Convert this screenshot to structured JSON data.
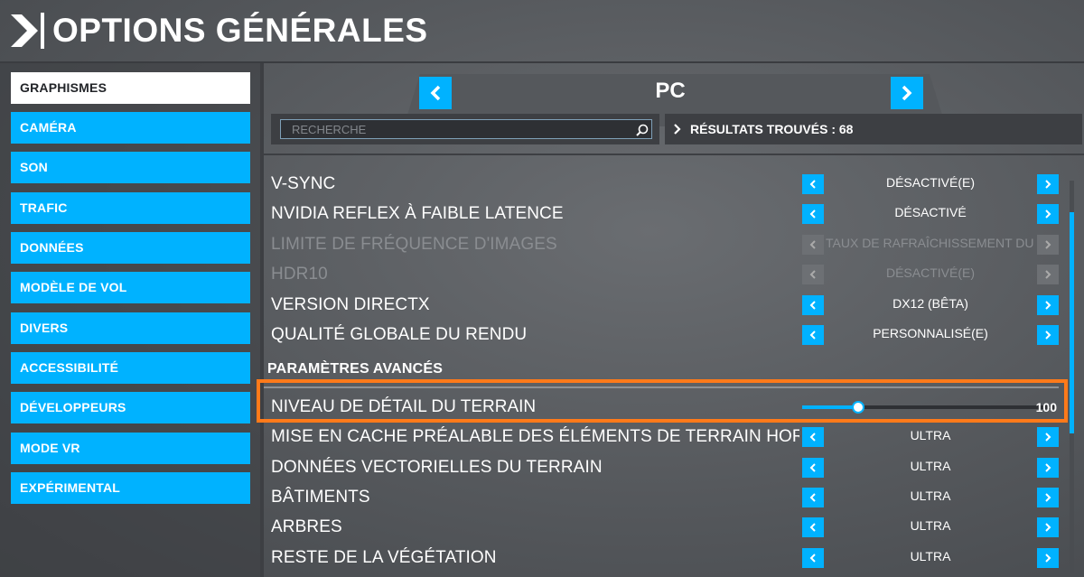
{
  "header": {
    "title": "OPTIONS GÉNÉRALES",
    "back_icon": "chevron-right-icon"
  },
  "sidebar": {
    "items": [
      {
        "label": "GRAPHISMES",
        "active": true
      },
      {
        "label": "CAMÉRA",
        "active": false
      },
      {
        "label": "SON",
        "active": false
      },
      {
        "label": "TRAFIC",
        "active": false
      },
      {
        "label": "DONNÉES",
        "active": false
      },
      {
        "label": "MODÈLE DE VOL",
        "active": false
      },
      {
        "label": "DIVERS",
        "active": false
      },
      {
        "label": "ACCESSIBILITÉ",
        "active": false
      },
      {
        "label": "DÉVELOPPEURS",
        "active": false
      },
      {
        "label": "MODE VR",
        "active": false
      },
      {
        "label": "EXPÉRIMENTAL",
        "active": false
      }
    ]
  },
  "platform": {
    "label": "PC"
  },
  "search": {
    "placeholder": "RECHERCHE",
    "value": ""
  },
  "results": {
    "text": "RÉSULTATS TROUVÉS : 68"
  },
  "settings": [
    {
      "label": "V-SYNC",
      "value": "DÉSACTIVÉ(E)",
      "disabled": false
    },
    {
      "label": "NVIDIA REFLEX À FAIBLE LATENCE",
      "value": "DÉSACTIVÉ",
      "disabled": false
    },
    {
      "label": "LIMITE DE FRÉQUENCE D'IMAGES",
      "value": "TAUX DE RAFRAÎCHISSEMENT DU MONITEUR",
      "disabled": true
    },
    {
      "label": "HDR10",
      "value": "DÉSACTIVÉ(E)",
      "disabled": true
    },
    {
      "label": "VERSION DIRECTX",
      "value": "DX12 (BÊTA)",
      "disabled": false
    },
    {
      "label": "QUALITÉ GLOBALE DU RENDU",
      "value": "PERSONNALISÉ(E)",
      "disabled": false
    }
  ],
  "advanced": {
    "title": "PARAMÈTRES AVANCÉS",
    "slider": {
      "label": "NIVEAU DE DÉTAIL DU TERRAIN",
      "value": "100",
      "fraction": 0.22
    },
    "settings": [
      {
        "label": "MISE EN CACHE PRÉALABLE DES ÉLÉMENTS DE TERRAIN HORS CHAMP",
        "value": "ULTRA"
      },
      {
        "label": "DONNÉES VECTORIELLES DU TERRAIN",
        "value": "ULTRA"
      },
      {
        "label": "BÂTIMENTS",
        "value": "ULTRA"
      },
      {
        "label": "ARBRES",
        "value": "ULTRA"
      },
      {
        "label": "RESTE DE LA VÉGÉTATION",
        "value": "ULTRA"
      }
    ]
  },
  "colors": {
    "accent": "#00b2ff",
    "highlight": "#ff7a1a",
    "active_tab": "#ffffff"
  }
}
